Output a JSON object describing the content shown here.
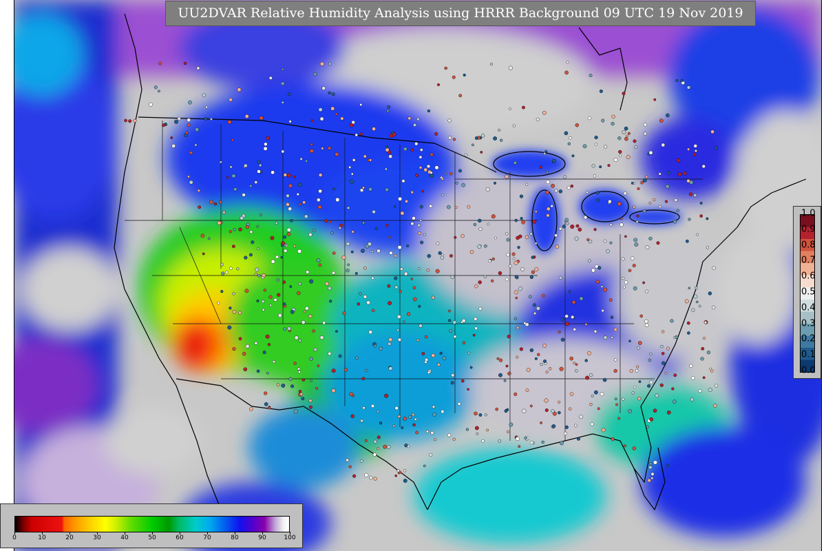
{
  "title": "UU2DVAR Relative Humidity Analysis using HRRR Background 09 UTC 19 Nov 2019",
  "map": {
    "projection": "lambert-conformal",
    "region": "CONUS",
    "field": "relative-humidity",
    "overlays": [
      "coastlines",
      "country-borders",
      "state-borders",
      "observation-markers"
    ],
    "background_color": "#c8c8c8"
  },
  "rh_colorbar": {
    "ticks": [
      "0",
      "10",
      "20",
      "30",
      "40",
      "50",
      "60",
      "70",
      "80",
      "90",
      "100"
    ],
    "stops": [
      {
        "value": 0,
        "color": "#000000"
      },
      {
        "value": 3,
        "color": "#7a0000"
      },
      {
        "value": 6,
        "color": "#cc0000"
      },
      {
        "value": 17,
        "color": "#ee1111"
      },
      {
        "value": 18,
        "color": "#ff6600"
      },
      {
        "value": 22,
        "color": "#ff9900"
      },
      {
        "value": 27,
        "color": "#ffcc00"
      },
      {
        "value": 33,
        "color": "#ffff00"
      },
      {
        "value": 37,
        "color": "#ccee00"
      },
      {
        "value": 42,
        "color": "#66dd00"
      },
      {
        "value": 50,
        "color": "#00cc00"
      },
      {
        "value": 56,
        "color": "#009900"
      },
      {
        "value": 60,
        "color": "#00bb66"
      },
      {
        "value": 66,
        "color": "#00cccc"
      },
      {
        "value": 71,
        "color": "#00aaee"
      },
      {
        "value": 76,
        "color": "#0066ee"
      },
      {
        "value": 82,
        "color": "#1111ee"
      },
      {
        "value": 87,
        "color": "#5500cc"
      },
      {
        "value": 91,
        "color": "#8800aa"
      },
      {
        "value": 95,
        "color": "#c2a8d8"
      },
      {
        "value": 98,
        "color": "#f2f2f2"
      },
      {
        "value": 100,
        "color": "#ffffff"
      }
    ]
  },
  "obs_colorbar": {
    "ticks": [
      "1.0",
      "0.9",
      "0.8",
      "0.7",
      "0.6",
      "0.5",
      "0.4",
      "0.3",
      "0.2",
      "0.1",
      "0.0"
    ],
    "bands": [
      "#7a0f1e",
      "#b3222e",
      "#d0533d",
      "#e08060",
      "#f0b195",
      "#f6dccf",
      "#eeeeee",
      "#cfdde0",
      "#a7c0c6",
      "#6b9cb0",
      "#3f78a0",
      "#1f5b8c",
      "#0b3a70"
    ]
  }
}
